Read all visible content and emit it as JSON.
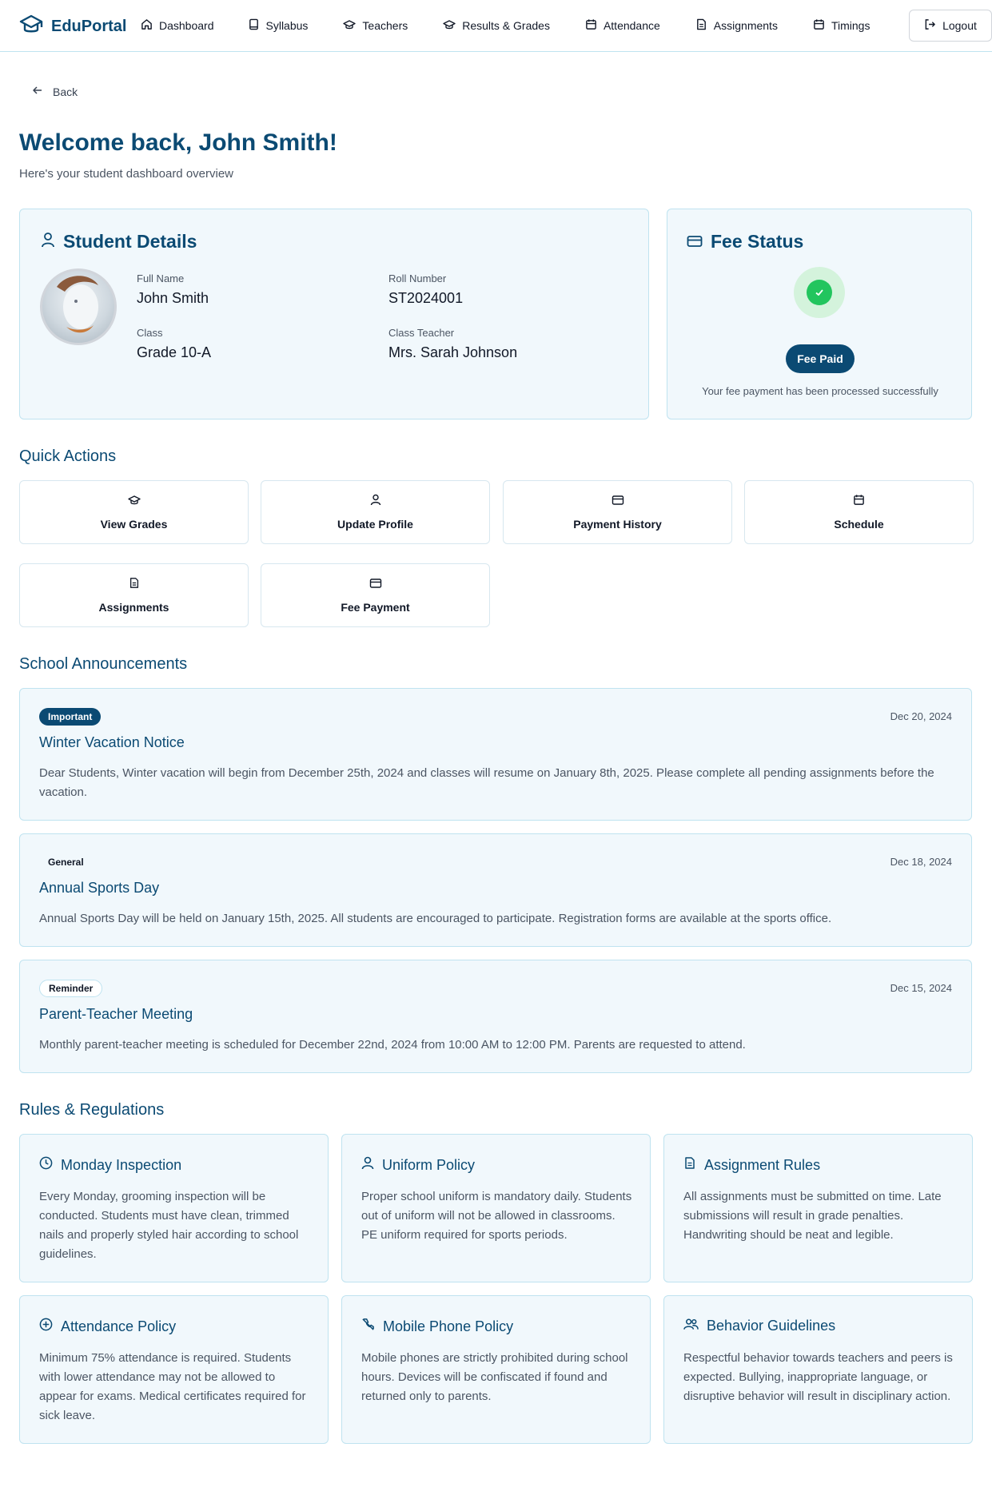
{
  "nav": {
    "brand": "EduPortal",
    "links": [
      {
        "label": "Dashboard",
        "icon": "home-icon"
      },
      {
        "label": "Syllabus",
        "icon": "book-icon"
      },
      {
        "label": "Teachers",
        "icon": "graduation-cap-icon"
      },
      {
        "label": "Results & Grades",
        "icon": "graduation-cap-icon"
      },
      {
        "label": "Attendance",
        "icon": "calendar-icon"
      },
      {
        "label": "Assignments",
        "icon": "file-icon"
      },
      {
        "label": "Timings",
        "icon": "calendar-icon"
      }
    ],
    "logout": "Logout"
  },
  "back": "Back",
  "header": {
    "title": "Welcome back, John Smith!",
    "subtitle": "Here's your student dashboard overview"
  },
  "student": {
    "heading": "Student Details",
    "full_name_label": "Full Name",
    "full_name": "John Smith",
    "roll_label": "Roll Number",
    "roll": "ST2024001",
    "class_label": "Class",
    "class": "Grade 10-A",
    "teacher_label": "Class Teacher",
    "teacher": "Mrs. Sarah Johnson"
  },
  "fee": {
    "heading": "Fee Status",
    "badge": "Fee Paid",
    "message": "Your fee payment has been processed successfully",
    "status_color": "#22c55e"
  },
  "quick_actions": {
    "title": "Quick Actions",
    "items": [
      {
        "label": "View Grades",
        "icon": "graduation-cap-icon"
      },
      {
        "label": "Update Profile",
        "icon": "user-icon"
      },
      {
        "label": "Payment History",
        "icon": "credit-card-icon"
      },
      {
        "label": "Schedule",
        "icon": "calendar-icon"
      },
      {
        "label": "Assignments",
        "icon": "file-icon"
      },
      {
        "label": "Fee Payment",
        "icon": "credit-card-icon"
      }
    ]
  },
  "announcements": {
    "title": "School Announcements",
    "items": [
      {
        "badge": "Important",
        "date": "Dec 20, 2024",
        "title": "Winter Vacation Notice",
        "body": "Dear Students, Winter vacation will begin from December 25th, 2024 and classes will resume on January 8th, 2025. Please complete all pending assignments before the vacation."
      },
      {
        "badge": "General",
        "date": "Dec 18, 2024",
        "title": "Annual Sports Day",
        "body": "Annual Sports Day will be held on January 15th, 2025. All students are encouraged to participate. Registration forms are available at the sports office."
      },
      {
        "badge": "Reminder",
        "date": "Dec 15, 2024",
        "title": "Parent-Teacher Meeting",
        "body": "Monthly parent-teacher meeting is scheduled for December 22nd, 2024 from 10:00 AM to 12:00 PM. Parents are requested to attend."
      }
    ]
  },
  "rules": {
    "title": "Rules & Regulations",
    "items": [
      {
        "title": "Monday Inspection",
        "icon": "clock-icon",
        "body": "Every Monday, grooming inspection will be conducted. Students must have clean, trimmed nails and properly styled hair according to school guidelines."
      },
      {
        "title": "Uniform Policy",
        "icon": "user-icon",
        "body": "Proper school uniform is mandatory daily. Students out of uniform will not be allowed in classrooms. PE uniform required for sports periods."
      },
      {
        "title": "Assignment Rules",
        "icon": "file-icon",
        "body": "All assignments must be submitted on time. Late submissions will result in grade penalties. Handwriting should be neat and legible."
      },
      {
        "title": "Attendance Policy",
        "icon": "plus-circle-icon",
        "body": "Minimum 75% attendance is required. Students with lower attendance may not be allowed to appear for exams. Medical certificates required for sick leave."
      },
      {
        "title": "Mobile Phone Policy",
        "icon": "phone-off-icon",
        "body": "Mobile phones are strictly prohibited during school hours. Devices will be confiscated if found and returned only to parents."
      },
      {
        "title": "Behavior Guidelines",
        "icon": "users-icon",
        "body": "Respectful behavior towards teachers and peers is expected. Bullying, inappropriate language, or disruptive behavior will result in disciplinary action."
      }
    ]
  }
}
